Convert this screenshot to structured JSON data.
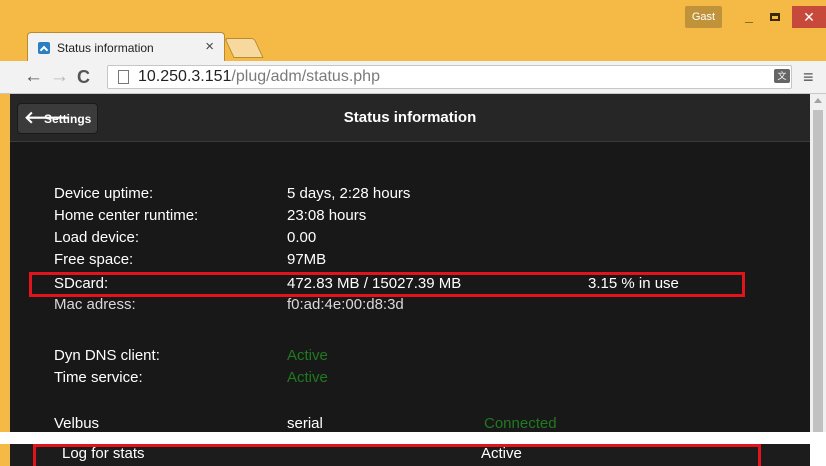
{
  "browser": {
    "user_label": "Gast",
    "tab_title": "Status information",
    "tab_close": "×",
    "url_host": "10.250.3.151",
    "url_path": "/plug/adm/status.php",
    "icons": {
      "back": "arrow-left-icon",
      "forward": "arrow-right-icon",
      "reload": "reload-icon",
      "menu": "hamburger-menu-icon",
      "translate": "translate-icon"
    },
    "colors": {
      "frame": "#f5b946",
      "close_button": "#c7493b"
    }
  },
  "header": {
    "back_label": "Settings",
    "title": "Status information"
  },
  "status_rows": [
    {
      "label": "Device uptime:",
      "value": "5 days, 2:28 hours"
    },
    {
      "label": "Home center runtime:",
      "value": "23:08 hours"
    },
    {
      "label": "Load device:",
      "value": "0.00"
    },
    {
      "label": "Free space:",
      "value": "97MB"
    },
    {
      "label": "SDcard:",
      "value": "472.83 MB / 15027.39 MB",
      "extra": "3.15 % in use"
    },
    {
      "label": "Mac adress:",
      "value": "f0:ad:4e:00:d8:3d"
    }
  ],
  "service_rows": [
    {
      "label": "Dyn DNS client:",
      "value": "Active"
    },
    {
      "label": "Time service:",
      "value": "Active"
    }
  ],
  "bus_row": {
    "label": "Velbus",
    "value": "serial",
    "status": "Connected"
  },
  "log_row": {
    "label": "Log for stats",
    "value": "Active"
  },
  "colors": {
    "status_green": "#1f7a1f",
    "highlight_border": "#e0141a",
    "page_bg": "#181818"
  }
}
